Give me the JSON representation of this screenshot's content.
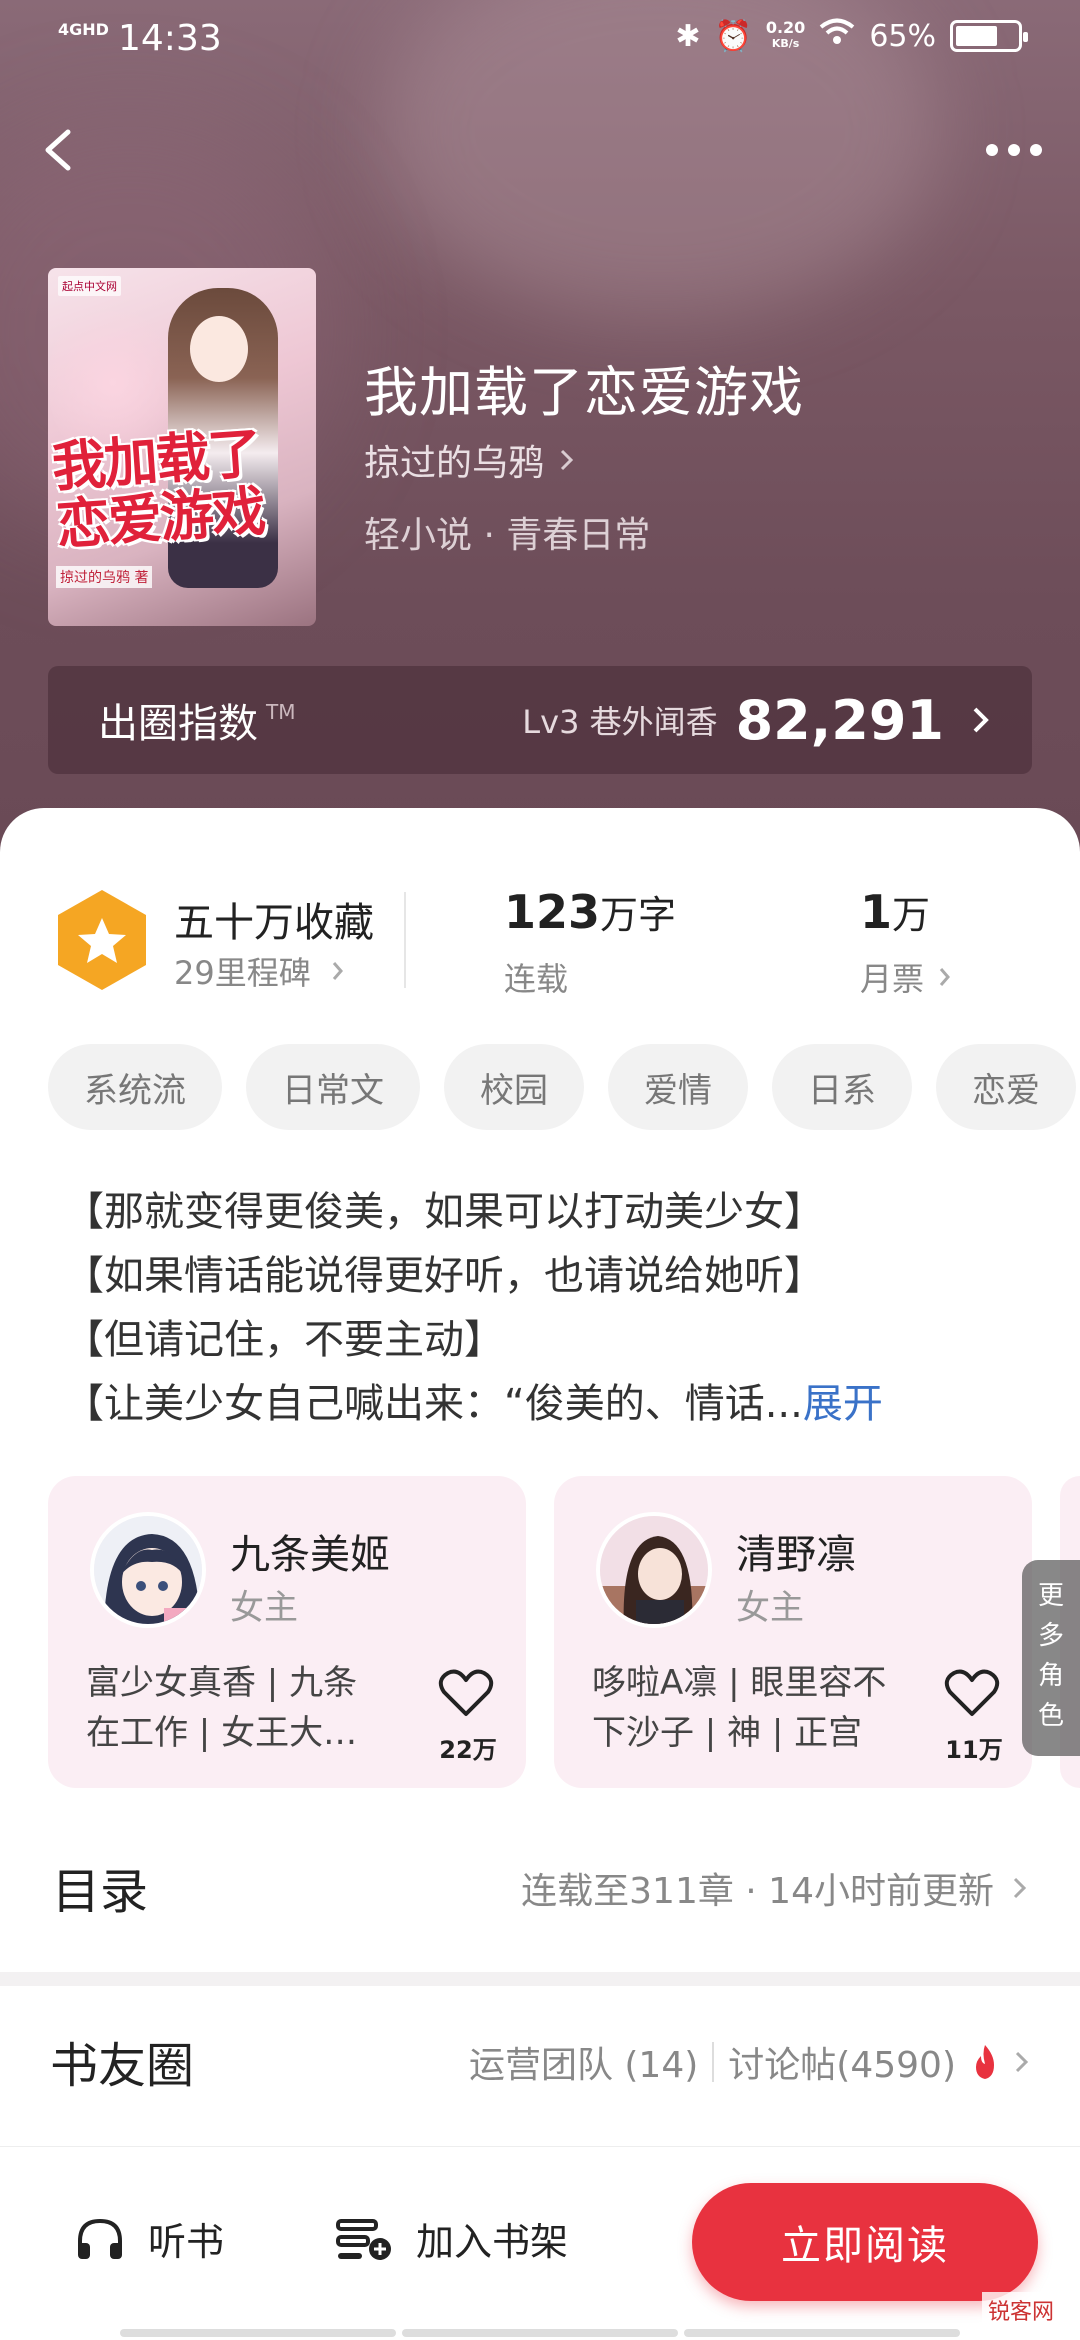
{
  "status": {
    "network": "4GHD",
    "time": "14:33",
    "speed_value": "0.20",
    "speed_unit": "KB/s",
    "battery": "65%",
    "battery_level": 0.65
  },
  "book": {
    "title": "我加载了恋爱游戏",
    "author": "掠过的乌鸦",
    "meta": "轻小说 · 青春日常",
    "cover_title_line1": "我加载了",
    "cover_title_line2": "恋爱游戏",
    "cover_author": "掠过的乌鸦 著",
    "cover_logo": "起点中文网"
  },
  "index": {
    "label": "出圈指数",
    "tm": "TM",
    "level": "Lv3 巷外闻香",
    "value": "82,291"
  },
  "stats": {
    "collect_title": "五十万收藏",
    "collect_sub": "29里程碑",
    "words_num": "123",
    "words_unit": "万字",
    "words_sub": "连载",
    "ticket_num": "1",
    "ticket_unit": "万",
    "ticket_sub": "月票"
  },
  "tags": [
    "系统流",
    "日常文",
    "校园",
    "爱情",
    "日系",
    "恋爱"
  ],
  "description": {
    "line1": "【那就变得更俊美，如果可以打动美少女】",
    "line2": "【如果情话能说得更好听，也请说给她听】",
    "line3": "【但请记住，不要主动】",
    "line4": "【让美少女自己喊出来：“俊美的、情话...",
    "expand": "展开"
  },
  "characters": [
    {
      "name": "九条美姬",
      "role": "女主",
      "desc": "富少女真香 | 九条在工作 | 女王大…",
      "likes": "22万"
    },
    {
      "name": "清野凛",
      "role": "女主",
      "desc": "哆啦A凛 | 眼里容不下沙子 | 神 | 正宫",
      "likes": "11万"
    }
  ],
  "more_characters": "更多角色",
  "catalog": {
    "title": "目录",
    "status": "连载至311章 · 14小时前更新"
  },
  "circle": {
    "title": "书友圈",
    "team": "运营团队 (14)",
    "posts": "讨论帖(4590)"
  },
  "bottom": {
    "listen": "听书",
    "shelf": "加入书架",
    "read": "立即阅读"
  },
  "watermark": "锐客网",
  "colors": {
    "accent_red": "#e8323f",
    "link_blue": "#3a72c8",
    "badge_orange": "#f5a623",
    "character_card_bg": "#fbeef4"
  }
}
